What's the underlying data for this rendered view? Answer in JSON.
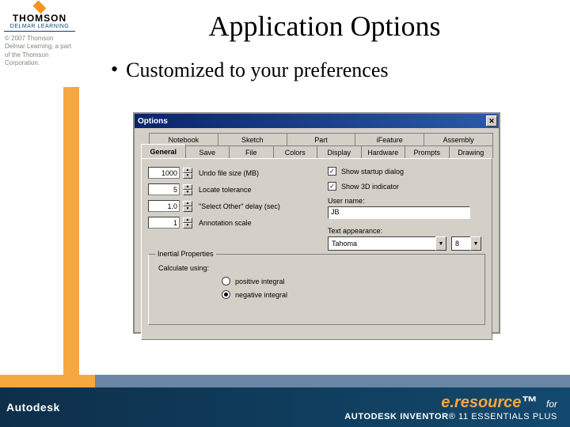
{
  "brand": {
    "thomson": "THOMSON",
    "delmar": "DELMAR LEARNING",
    "copyright": "© 2007 Thomson Delmar Learning, a part of the Thomson Corporation."
  },
  "title": "Application Options",
  "bullet": "Customized to your preferences",
  "dialog": {
    "title": "Options",
    "tabs_top": [
      "Notebook",
      "Sketch",
      "Part",
      "iFeature",
      "Assembly"
    ],
    "tabs_bottom": [
      "General",
      "Save",
      "File",
      "Colors",
      "Display",
      "Hardware",
      "Prompts",
      "Drawing"
    ],
    "left": {
      "undo_value": "1000",
      "undo_label": "Undo file size (MB)",
      "locate_value": "5",
      "locate_label": "Locate tolerance",
      "select_value": "1.0",
      "select_label": "\"Select Other\" delay (sec)",
      "annot_value": "1",
      "annot_label": "Annotation scale"
    },
    "right": {
      "startup": "Show startup dialog",
      "indicator": "Show 3D indicator",
      "username_label": "User name:",
      "username_value": "JB",
      "textapp_label": "Text appearance:",
      "font_value": "Tahoma",
      "size_value": "8"
    },
    "group": {
      "title": "Inertial Properties",
      "subtitle": "Calculate using:",
      "opt1": "positive integral",
      "opt2": "negative integral"
    }
  },
  "footer": {
    "autodesk": "Autodesk",
    "eresource": "e.resource",
    "tm": "™",
    "for": "for",
    "product1": "AUTODESK INVENTOR",
    "reg": "®",
    "product2": " 11 ESSENTIALS PLUS"
  }
}
